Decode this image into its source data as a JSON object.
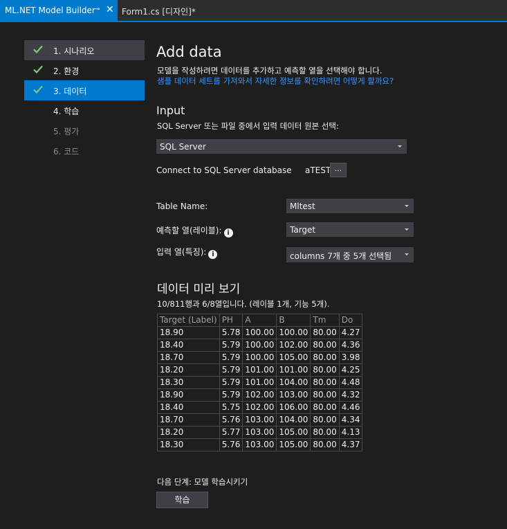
{
  "tabs": {
    "active": "ML.NET Model Builder",
    "pin": "⊸",
    "close": "✕",
    "second": "Form1.cs [디자인]*"
  },
  "nav": {
    "items": [
      {
        "label": "1. 시나리오",
        "state": "done"
      },
      {
        "label": "2. 환경",
        "state": "done"
      },
      {
        "label": "3. 데이터",
        "state": "active"
      },
      {
        "label": "4. 학습",
        "state": "enabled"
      },
      {
        "label": "5. 평가",
        "state": "disabled"
      },
      {
        "label": "6. 코드",
        "state": "disabled"
      }
    ]
  },
  "main": {
    "title": "Add data",
    "description": "모델을 작성하려면 데이터를 추가하고 예측할 열을 선택해야 합니다.",
    "help_link": "샘플 데이터 세트를 가져와서 자세한 정보를 확인하려면 어떻게 할까요?",
    "input_heading": "Input",
    "input_desc": "SQL Server 또는 파일 중에서 입력 데이터 원본 선택:",
    "source_select": "SQL Server",
    "connect_label": "Connect to SQL Server database",
    "connect_value": "aTEST",
    "browse_label": "...",
    "table_name_label": "Table Name:",
    "table_name_value": "Mltest",
    "label_col_label": "예측할 열(레이블):",
    "label_col_value": "Target",
    "feature_label": "입력 열(특징):",
    "feature_value": "columns 7개 중 5개 선택됨",
    "info_glyph": "i",
    "preview_heading": "데이터 미리 보기",
    "preview_summary": "10/811행과 6/8열입니다. (레이블 1개, 기능 5개).",
    "next_step": "다음 단계: 모델 학습시키기",
    "train_button": "학습"
  },
  "table": {
    "headers": [
      "Target (Label)",
      "PH",
      "A",
      "B",
      "Tm",
      "Do"
    ],
    "rows": [
      [
        "18.90",
        "5.78",
        "100.00",
        "100.00",
        "80.00",
        "4.27"
      ],
      [
        "18.40",
        "5.79",
        "100.00",
        "102.00",
        "80.00",
        "4.36"
      ],
      [
        "18.70",
        "5.79",
        "100.00",
        "105.00",
        "80.00",
        "3.98"
      ],
      [
        "18.20",
        "5.79",
        "101.00",
        "101.00",
        "80.00",
        "4.25"
      ],
      [
        "18.30",
        "5.79",
        "101.00",
        "104.00",
        "80.00",
        "4.48"
      ],
      [
        "18.90",
        "5.79",
        "102.00",
        "103.00",
        "80.00",
        "4.32"
      ],
      [
        "18.40",
        "5.75",
        "102.00",
        "106.00",
        "80.00",
        "4.46"
      ],
      [
        "18.70",
        "5.76",
        "103.00",
        "104.00",
        "80.00",
        "4.34"
      ],
      [
        "18.20",
        "5.77",
        "103.00",
        "105.00",
        "80.00",
        "4.13"
      ],
      [
        "18.30",
        "5.76",
        "103.00",
        "105.00",
        "80.00",
        "4.37"
      ]
    ]
  },
  "colors": {
    "accent": "#007acc",
    "link": "#3794ff",
    "check": "#7fc97f"
  }
}
